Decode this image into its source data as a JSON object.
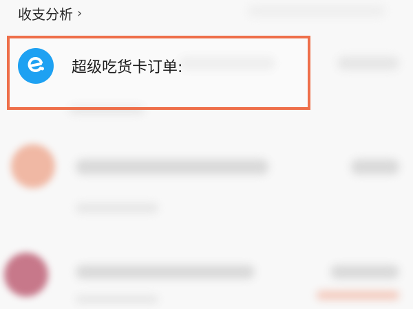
{
  "header": {
    "title": "收支分析",
    "chevron": "›"
  },
  "rows": [
    {
      "title": "超级吃货卡订单:",
      "icon": "eleme-logo-icon",
      "icon_color": "#1ea1f2"
    }
  ],
  "colors": {
    "highlight": "#ee6f4a",
    "background": "#f8f8f8"
  }
}
